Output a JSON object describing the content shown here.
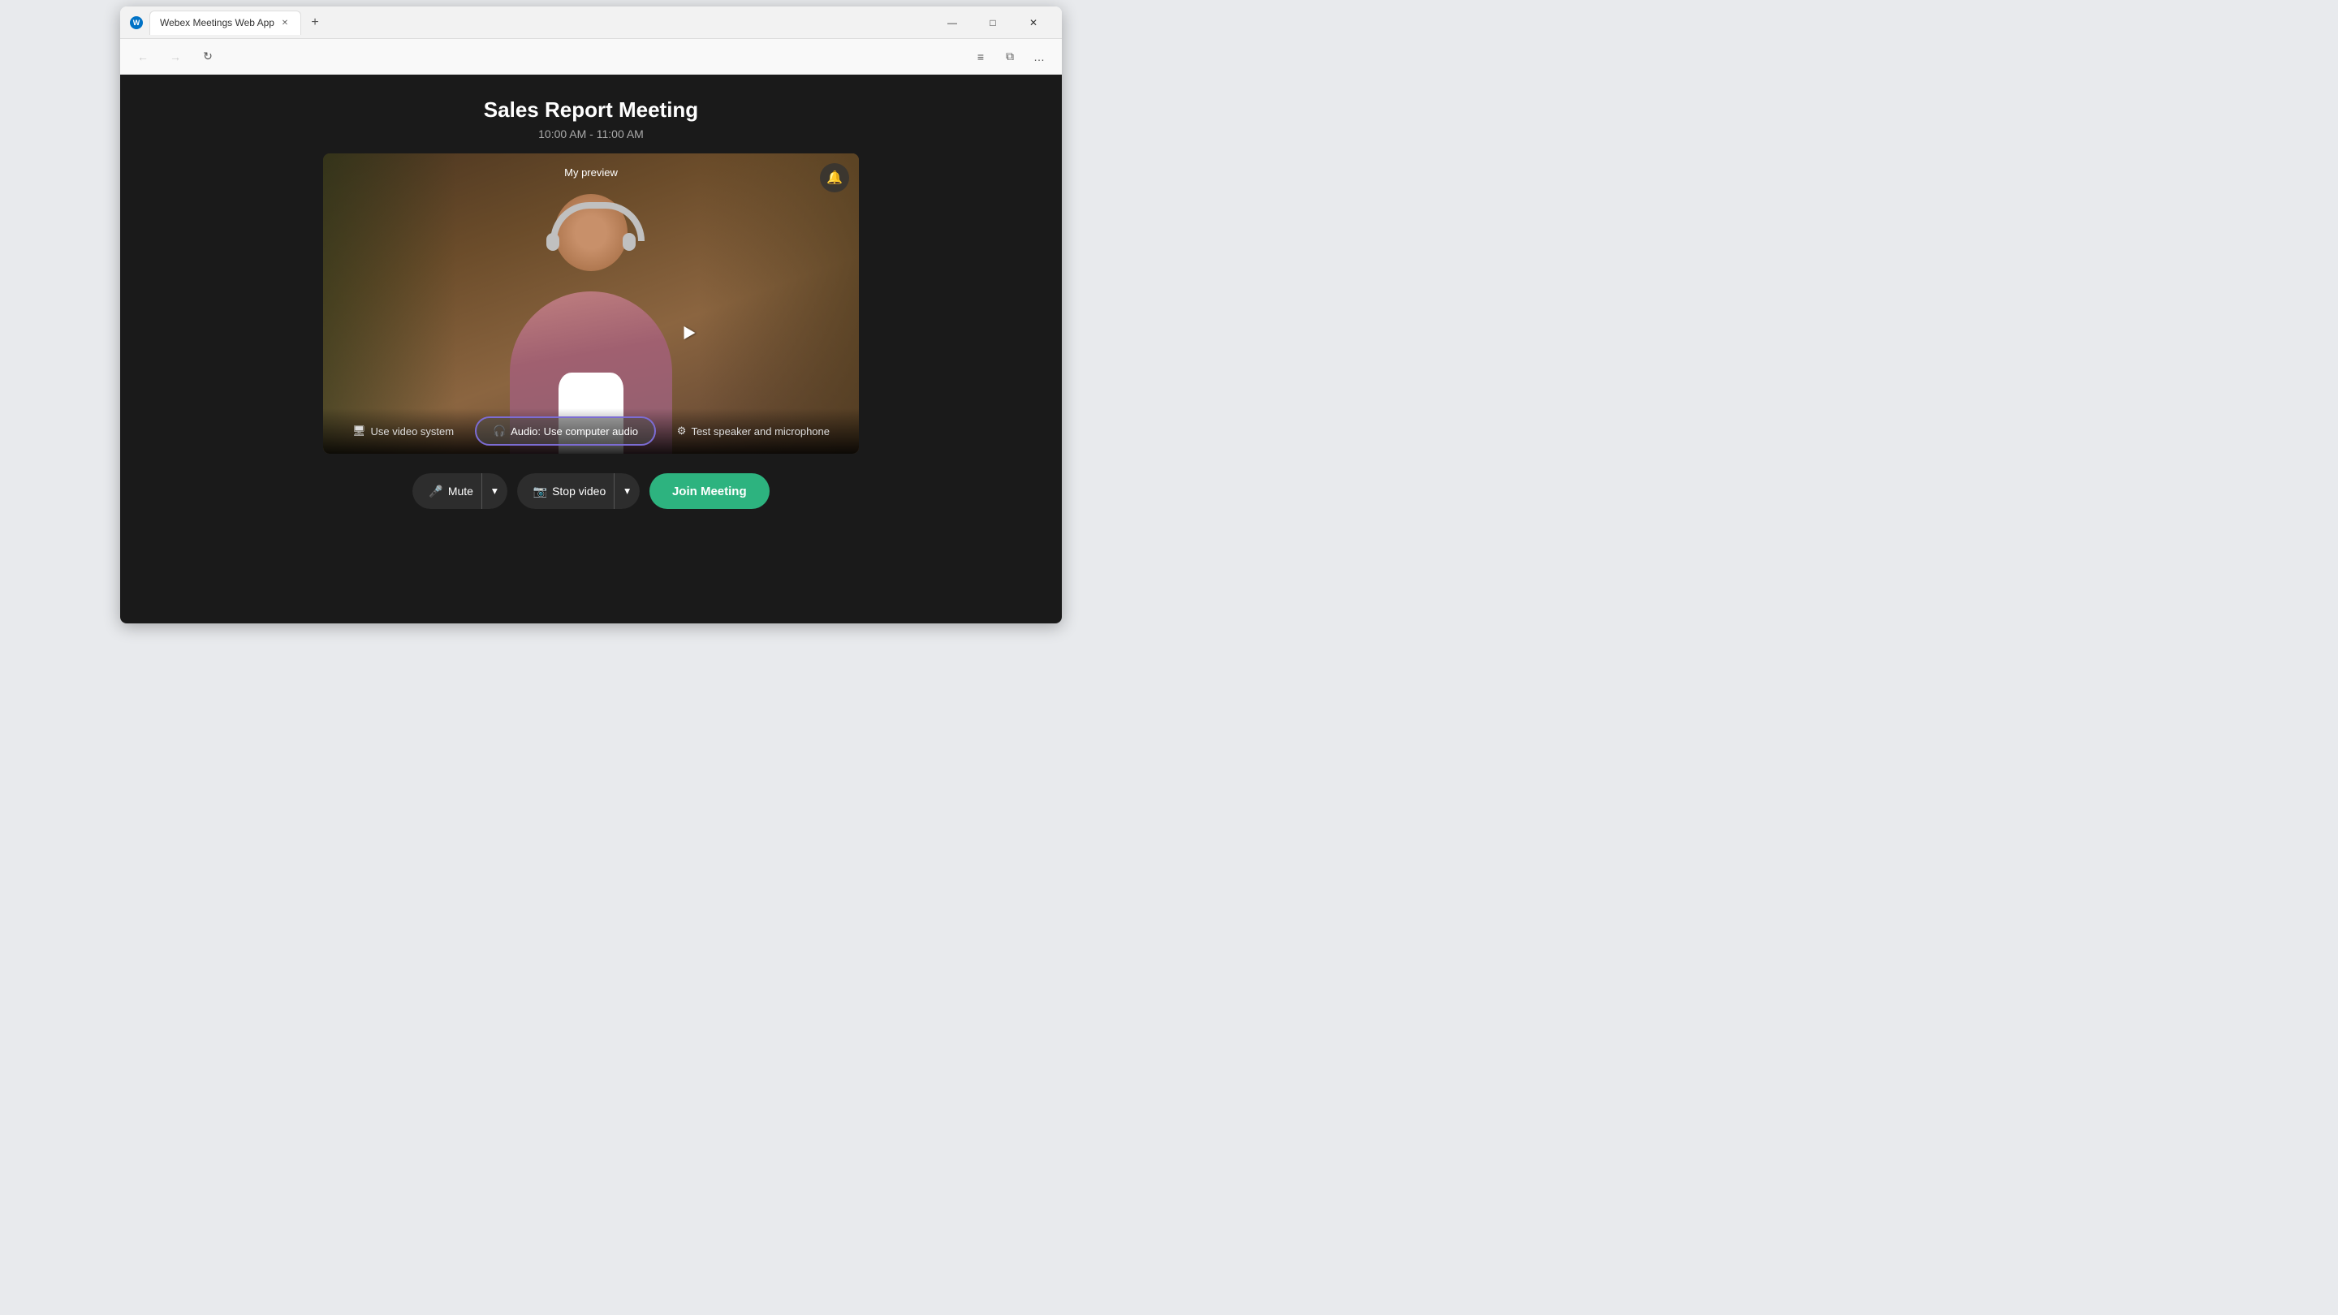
{
  "browser": {
    "tab_icon": "W",
    "tab_title": "Webex Meetings Web App",
    "new_tab_label": "+",
    "window_controls": {
      "minimize": "—",
      "maximize": "□",
      "close": "✕"
    }
  },
  "nav": {
    "back_label": "←",
    "forward_label": "→",
    "refresh_label": "↻",
    "sidebar_label": "≡",
    "split_label": "⧉",
    "more_label": "…"
  },
  "meeting": {
    "title": "Sales Report Meeting",
    "time": "10:00 AM - 11:00 AM"
  },
  "preview": {
    "label": "My preview"
  },
  "video_controls": {
    "use_video_system": "Use video system",
    "audio_button": "Audio: Use computer audio",
    "test_speaker": "Test speaker and microphone"
  },
  "bottom_controls": {
    "mute_label": "Mute",
    "stop_video_label": "Stop video",
    "join_label": "Join Meeting"
  },
  "colors": {
    "join_btn_bg": "#2db37f",
    "audio_btn_border": "#7c6cd4",
    "web_bg": "#1a1a1a"
  }
}
